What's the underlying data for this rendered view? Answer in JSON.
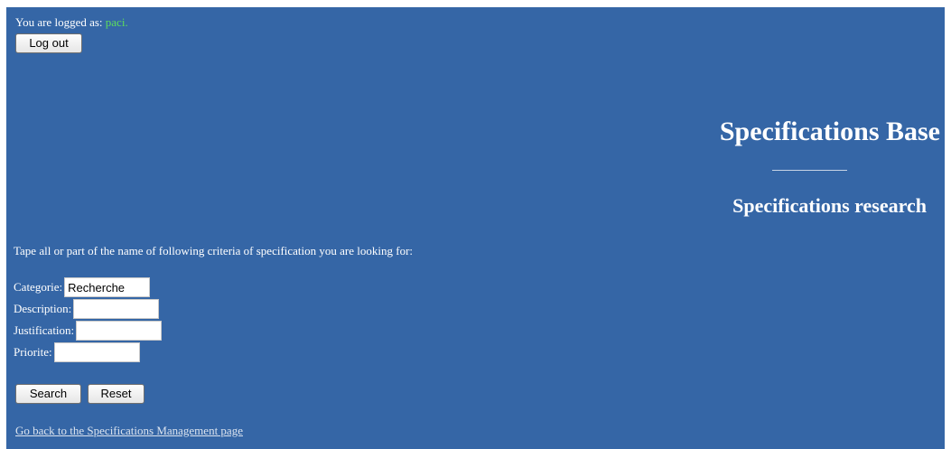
{
  "session": {
    "logged_prefix": "You are logged as:",
    "username": "paci",
    "suffix": ".",
    "logout_label": "Log out"
  },
  "header": {
    "title": "Specifications Base",
    "subtitle": "Specifications research"
  },
  "form": {
    "instructions": "Tape all or part of the name of following criteria of specification you are looking for:",
    "fields": [
      {
        "label": "Categorie:",
        "value": "Recherche"
      },
      {
        "label": "Description:",
        "value": ""
      },
      {
        "label": "Justification:",
        "value": ""
      },
      {
        "label": "Priorite:",
        "value": ""
      }
    ],
    "search_label": "Search",
    "reset_label": "Reset"
  },
  "footer": {
    "back_link": "Go back to the Specifications Management page"
  },
  "colors": {
    "background": "#3566a6",
    "username": "#5ddc5d"
  }
}
